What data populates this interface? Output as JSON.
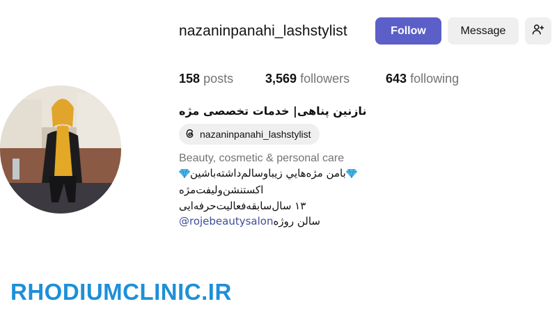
{
  "profile": {
    "username": "nazaninpanahi_lashstylist",
    "follow_label": "Follow",
    "message_label": "Message",
    "add_user_icon": "person-add-icon",
    "stats": {
      "posts_count": "158",
      "posts_label": "posts",
      "followers_count": "3,569",
      "followers_label": "followers",
      "following_count": "643",
      "following_label": "following"
    },
    "full_name": "نازنین پناهی| خدمات تخصصی مژه",
    "threads_handle": "nazaninpanahi_lashstylist",
    "category": "Beauty, cosmetic & personal care",
    "bio": {
      "line1": "بامن مژه‌هايي زيباوسالم‌داشته‌باشين",
      "line2": "اکستنشن‌ولیفت‌مژه",
      "line3": "۱۳ سال‌سابقه‌فعالیت‌حرفه‌ایی",
      "line4_mention": "@rojebeautysalon",
      "line4_text": "سالن روژه"
    }
  },
  "watermark": "RHODIUMCLINIC.IR",
  "colors": {
    "follow_bg": "#5b5fc7",
    "secondary_btn_bg": "#efefef",
    "mention": "#3f4c9a",
    "watermark": "#1e8fd8",
    "muted_text": "#737373"
  }
}
